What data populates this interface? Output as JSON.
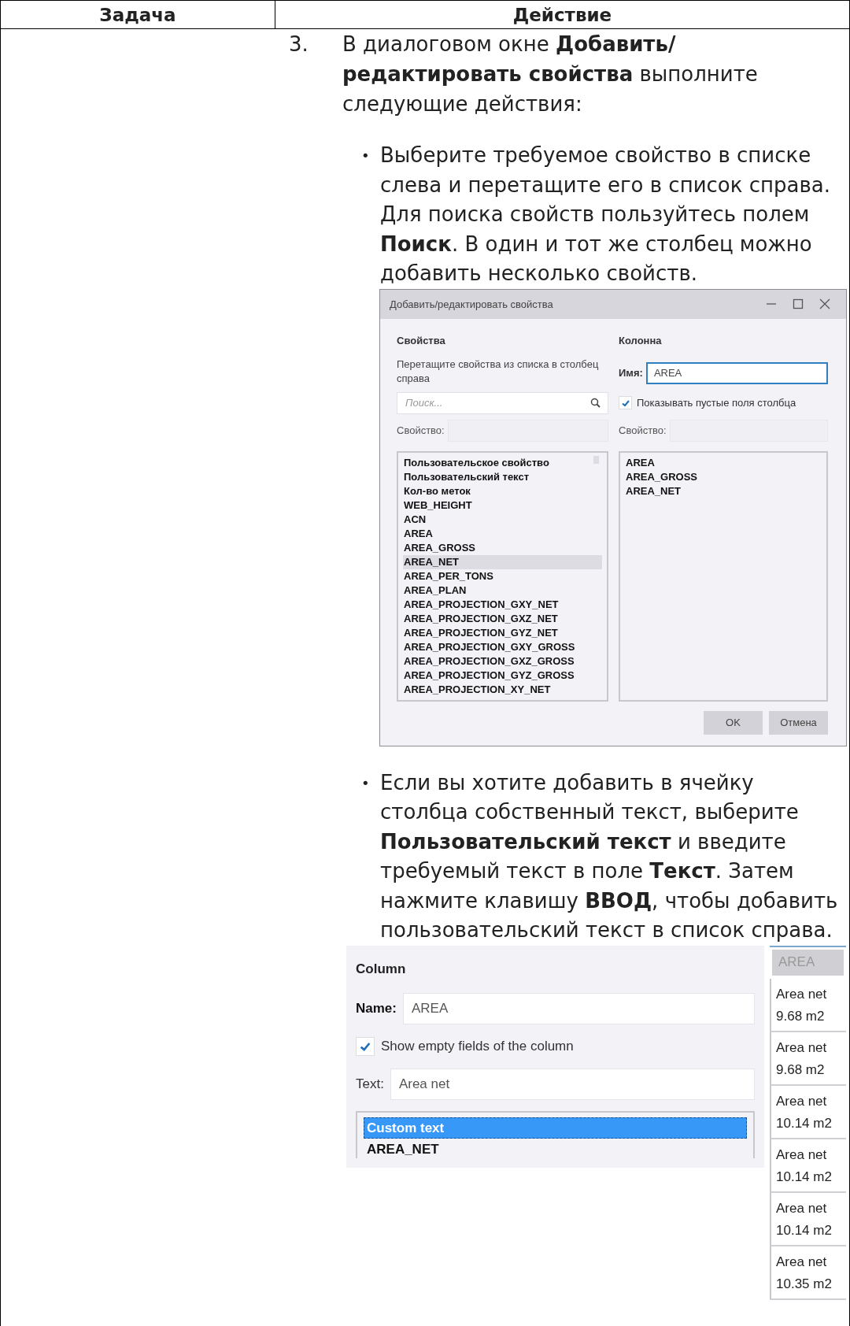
{
  "table": {
    "columns": [
      "Задача",
      "Действие"
    ],
    "steps": [
      {
        "number": "3.",
        "text": "В диалоговом окне **Добавить/редактировать свойства** выполните следующие действия:",
        "bullets": [
          {
            "marker": "•",
            "text": "Выберите требуемое свойство в списке слева и перетащите его в список справа. Для поиска свойств пользуйтесь полем **Поиск**. В один и тот же столбец можно добавить несколько свойств.",
            "figure": {
              "kind": "properties_dialog",
              "title": "Добавить/редактировать свойства",
              "left": {
                "heading": "Свойства",
                "hint": "Перетащите свойства из списка в столбец справа",
                "search_placeholder": "Поиск...",
                "property_label": "Свойство:",
                "items": [
                  {
                    "label": "Пользовательское свойство",
                    "selected": false
                  },
                  {
                    "label": "Пользовательский текст",
                    "selected": false
                  },
                  {
                    "label": "Кол-во меток",
                    "selected": false
                  },
                  {
                    "label": "WEB_HEIGHT",
                    "selected": false
                  },
                  {
                    "label": "ACN",
                    "selected": false
                  },
                  {
                    "label": "AREA",
                    "selected": false
                  },
                  {
                    "label": "AREA_GROSS",
                    "selected": false
                  },
                  {
                    "label": "AREA_NET",
                    "selected": true
                  },
                  {
                    "label": "AREA_PER_TONS",
                    "selected": false
                  },
                  {
                    "label": "AREA_PLAN",
                    "selected": false
                  },
                  {
                    "label": "AREA_PROJECTION_GXY_NET",
                    "selected": false
                  },
                  {
                    "label": "AREA_PROJECTION_GXZ_NET",
                    "selected": false
                  },
                  {
                    "label": "AREA_PROJECTION_GYZ_NET",
                    "selected": false
                  },
                  {
                    "label": "AREA_PROJECTION_GXY_GROSS",
                    "selected": false
                  },
                  {
                    "label": "AREA_PROJECTION_GXZ_GROSS",
                    "selected": false
                  },
                  {
                    "label": "AREA_PROJECTION_GYZ_GROSS",
                    "selected": false
                  },
                  {
                    "label": "AREA_PROJECTION_XY_NET",
                    "selected": false
                  }
                ]
              },
              "right": {
                "heading": "Колонна",
                "name_label": "Имя:",
                "name_value": "AREA",
                "show_empty": {
                  "label": "Показывать пустые поля столбца",
                  "checked": true
                },
                "property_label": "Свойство:",
                "items": [
                  {
                    "label": "AREA",
                    "selected": false
                  },
                  {
                    "label": "AREA_GROSS",
                    "selected": false
                  },
                  {
                    "label": "AREA_NET",
                    "selected": false
                  }
                ]
              },
              "buttons": [
                "OK",
                "Отмена"
              ]
            }
          },
          {
            "marker": "•",
            "text": "Если вы хотите добавить в ячейку столбца собственный текст, выберите **Пользовательский текст** и введите требуемый текст в поле **Текст**. Затем нажмите клавишу **ВВОД**, чтобы добавить пользовательский текст в список справа.",
            "figure": {
              "kind": "column_panel",
              "heading": "Column",
              "name_label": "Name:",
              "name_value": "AREA",
              "show_empty": {
                "label": "Show empty fields of the column",
                "checked": true
              },
              "text_label": "Text:",
              "text_value": "Area net",
              "items": [
                {
                  "label": "Custom text",
                  "selected": true
                },
                {
                  "label": "AREA_NET",
                  "selected": false
                }
              ],
              "preview": {
                "header": "AREA",
                "cells": [
                  {
                    "label": "Area net",
                    "value": "9.68 m2"
                  },
                  {
                    "label": "Area net",
                    "value": "9.68 m2"
                  },
                  {
                    "label": "Area net",
                    "value": "10.14 m2"
                  },
                  {
                    "label": "Area net",
                    "value": "10.14 m2"
                  },
                  {
                    "label": "Area net",
                    "value": "10.14 m2"
                  },
                  {
                    "label": "Area net",
                    "value": "10.35 m2"
                  }
                ]
              }
            }
          }
        ]
      }
    ]
  }
}
